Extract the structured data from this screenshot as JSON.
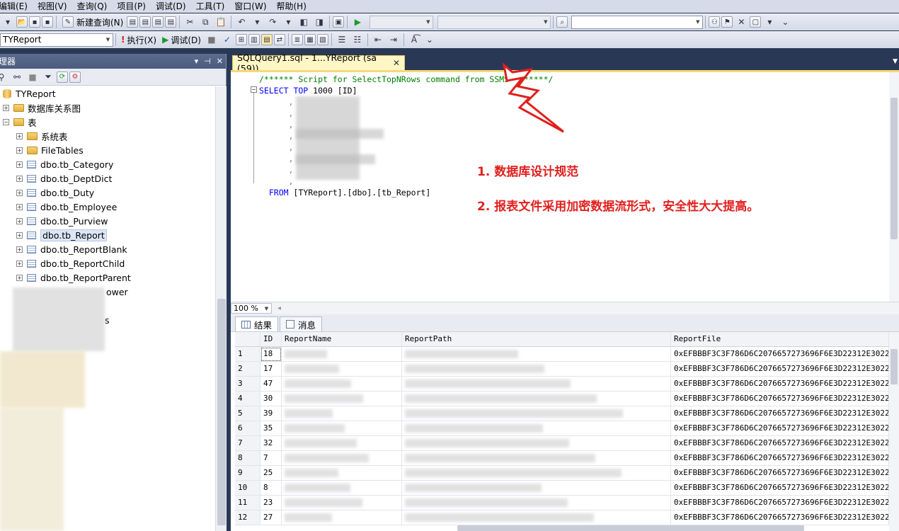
{
  "menu": [
    "编辑(E)",
    "视图(V)",
    "查询(Q)",
    "项目(P)",
    "调试(D)",
    "工具(T)",
    "窗口(W)",
    "帮助(H)"
  ],
  "toolbar": {
    "new_query": "新建查询(N)",
    "database": "TYReport",
    "execute": "执行(X)",
    "debug": "调试(D)"
  },
  "object_explorer": {
    "title": "理器",
    "nodes": {
      "db": "TYReport",
      "diagrams": "数据库关系图",
      "tables": "表",
      "system_tables": "系统表",
      "file_tables": "FileTables",
      "t1": "dbo.tb_Category",
      "t2": "dbo.tb_DeptDict",
      "t3": "dbo.tb_Duty",
      "t4": "dbo.tb_Employee",
      "t5": "dbo.tb_Purview",
      "t6": "dbo.tb_Report",
      "t7": "dbo.tb_ReportBlank",
      "t8": "dbo.tb_ReportChild",
      "t9": "dbo.tb_ReportParent",
      "partial1": "ower",
      "partial2": "s"
    }
  },
  "doc_tab": {
    "title": "SQLQuery1.sql - 1...YReport (sa (59))",
    "close": "✕"
  },
  "editor": {
    "line1": "/****** Script for SelectTopNRows command from SSMS  ******/",
    "line2_kw": "SELECT TOP",
    "line2_num": " 1000 ",
    "line2_id": "[ID]",
    "from_kw": "FROM",
    "from_obj": " [TYReport].[dbo].[tb_Report]",
    "annotation1": "1. 数据库设计规范",
    "annotation2": "2. 报表文件采用加密数据流形式，安全性大大提高。"
  },
  "zoom": "100 %",
  "results_tabs": {
    "results": "结果",
    "messages": "消息"
  },
  "grid": {
    "headers": [
      "ID",
      "ReportName",
      "ReportPath",
      "ReportFile"
    ],
    "rows": [
      {
        "n": "1",
        "id": "18",
        "file": "0xEFBBBF3C3F786D6C2076657273696F6E3D22312E30222..."
      },
      {
        "n": "2",
        "id": "17",
        "file": "0xEFBBBF3C3F786D6C2076657273696F6E3D22312E30222..."
      },
      {
        "n": "3",
        "id": "47",
        "file": "0xEFBBBF3C3F786D6C2076657273696F6E3D22312E30222..."
      },
      {
        "n": "4",
        "id": "30",
        "file": "0xEFBBBF3C3F786D6C2076657273696F6E3D22312E30222..."
      },
      {
        "n": "5",
        "id": "39",
        "file": "0xEFBBBF3C3F786D6C2076657273696F6E3D22312E30222..."
      },
      {
        "n": "6",
        "id": "35",
        "file": "0xEFBBBF3C3F786D6C2076657273696F6E3D22312E30222..."
      },
      {
        "n": "7",
        "id": "32",
        "file": "0xEFBBBF3C3F786D6C2076657273696F6E3D22312E30222..."
      },
      {
        "n": "8",
        "id": "7",
        "file": "0xEFBBBF3C3F786D6C2076657273696F6E3D22312E30222..."
      },
      {
        "n": "9",
        "id": "25",
        "file": "0xEFBBBF3C3F786D6C2076657273696F6E3D22312E30222..."
      },
      {
        "n": "10",
        "id": "8",
        "file": "0xEFBBBF3C3F786D6C2076657273696F6E3D22312E30222..."
      },
      {
        "n": "11",
        "id": "23",
        "file": "0xEFBBBF3C3F786D6C2076657273696F6E3D22312E30222..."
      },
      {
        "n": "12",
        "id": "27",
        "file": "0xEFBBBF3C3F786D6C2076657273696F6E3D22312E30222..."
      }
    ]
  },
  "colors": {
    "accent_tab": "#fff6c5",
    "annotation": "#e0201e",
    "chrome": "#293955"
  }
}
